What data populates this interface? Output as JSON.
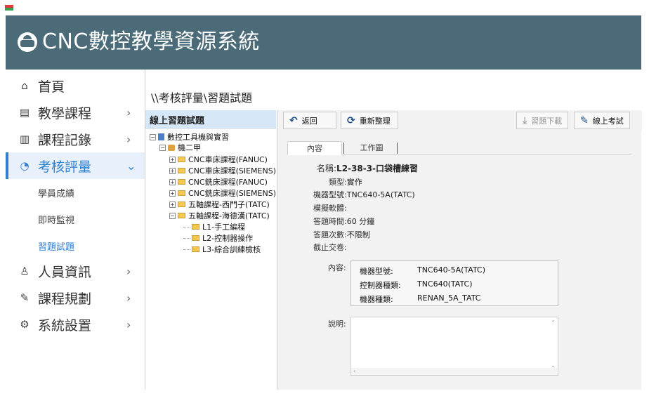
{
  "app": {
    "title": "CNC數控教學資源系統"
  },
  "sidebar": {
    "items": [
      {
        "label": "首頁",
        "icon": "home-icon",
        "has_submenu": false
      },
      {
        "label": "教學課程",
        "icon": "monitor-icon",
        "has_submenu": true
      },
      {
        "label": "課程記錄",
        "icon": "document-icon",
        "has_submenu": true
      },
      {
        "label": "考核評量",
        "icon": "pie-chart-icon",
        "has_submenu": true,
        "expanded": true
      },
      {
        "label": "人員資訊",
        "icon": "user-icon",
        "has_submenu": true
      },
      {
        "label": "課程規劃",
        "icon": "pencil-icon",
        "has_submenu": true
      },
      {
        "label": "系統設置",
        "icon": "gear-icon",
        "has_submenu": true
      }
    ],
    "subitems": [
      {
        "label": "學員成績"
      },
      {
        "label": "即時監視"
      },
      {
        "label": "習題試題",
        "current": true
      }
    ],
    "accent_color": "#2f80d1"
  },
  "breadcrumb": "\\\\考核評量\\習題試題",
  "tree": {
    "header": "線上習題試題",
    "root": "數控工具機與實習",
    "group": "機二甲",
    "courses": [
      "CNC車床課程(FANUC)",
      "CNC車床課程(SIEMENS)",
      "CNC銑床課程(FANUC)",
      "CNC銑床課程(SIEMENS)",
      "五軸課程-西門子(TATC)",
      "五軸課程-海德漢(TATC)"
    ],
    "lessons": [
      "L1-手工編程",
      "L2-控制器操作",
      "L3-綜合訓練檢核"
    ]
  },
  "toolbar": {
    "back": "返回",
    "refresh": "重新整理",
    "download": "習題下載",
    "online_exam": "線上考試"
  },
  "tabs": {
    "content": "內容",
    "workspace": "工作圖"
  },
  "detail": {
    "name_label": "名稱:",
    "name_value": "L2-38-3-口袋槽練習",
    "type_label": "類型:",
    "type_value": "實作",
    "model_label": "機器型號:",
    "model_value": "TNC640-5A(TATC)",
    "software_label": "模擬軟體:",
    "software_value": "",
    "time_label": "答題時間:",
    "time_value": "60 分鐘",
    "attempts_label": "答題次數:",
    "attempts_value": "不限制",
    "deadline_label": "截止交卷:",
    "deadline_value": "",
    "content_label": "內容:",
    "content_rows": [
      {
        "key": "機器型號:",
        "value": "TNC640-5A(TATC)"
      },
      {
        "key": "控制器種類:",
        "value": "TNC640(TATC)"
      },
      {
        "key": "機器種類:",
        "value": "RENAN_5A_TATC"
      }
    ],
    "desc_label": "說明:"
  },
  "colors": {
    "header_bg": "#4a6b77",
    "tree_header_bg": "#d6e8f7",
    "content_bg": "#f2f2f2"
  }
}
